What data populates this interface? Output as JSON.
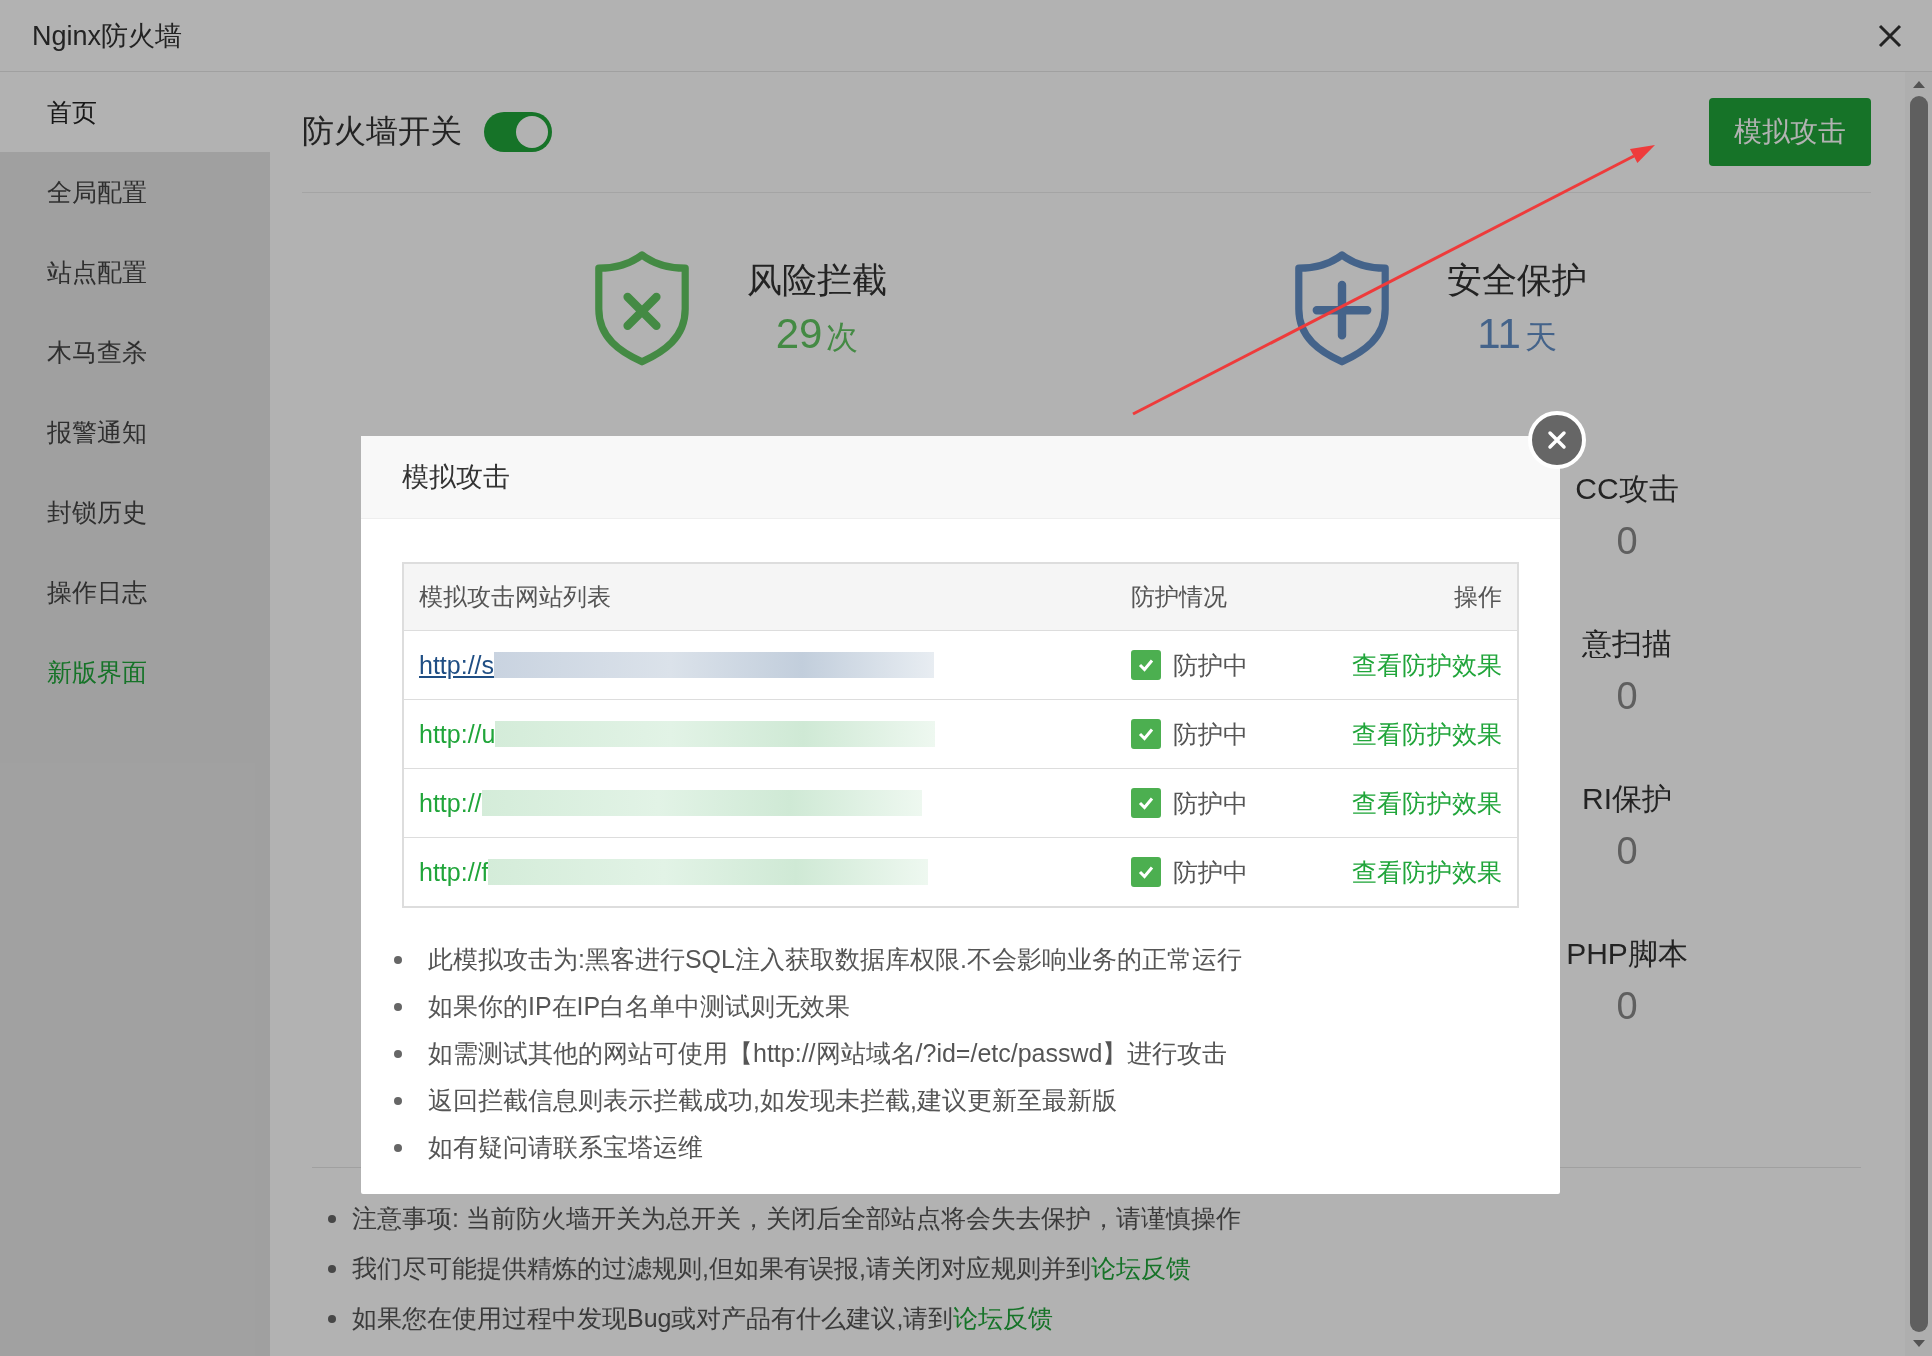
{
  "window": {
    "title": "Nginx防火墙"
  },
  "sidebar": {
    "items": [
      {
        "label": "首页",
        "selected": true,
        "kind": "page"
      },
      {
        "label": "全局配置",
        "selected": false,
        "kind": "page"
      },
      {
        "label": "站点配置",
        "selected": false,
        "kind": "page"
      },
      {
        "label": "木马查杀",
        "selected": false,
        "kind": "page"
      },
      {
        "label": "报警通知",
        "selected": false,
        "kind": "page"
      },
      {
        "label": "封锁历史",
        "selected": false,
        "kind": "page"
      },
      {
        "label": "操作日志",
        "selected": false,
        "kind": "page"
      },
      {
        "label": "新版界面",
        "selected": false,
        "kind": "link"
      }
    ]
  },
  "header": {
    "switch": {
      "label": "防火墙开关",
      "on": true
    },
    "button": "模拟攻击"
  },
  "stats": [
    {
      "kind": "blocked",
      "title": "风险拦截",
      "value": "29",
      "unit": "次",
      "color": "#448a44"
    },
    {
      "kind": "protected",
      "title": "安全保护",
      "value": "11",
      "unit": "天",
      "color": "#44638a"
    }
  ],
  "rules": [
    {
      "label": "CC攻击",
      "value": "0"
    },
    {
      "label": "意扫描",
      "value": "0"
    },
    {
      "label": "RI保护",
      "value": "0"
    },
    {
      "label": "PHP脚本",
      "value": "0"
    }
  ],
  "notes": [
    {
      "text": "注意事项: 当前防火墙开关为总开关，关闭后全部站点将会失去保护，请谨慎操作"
    },
    {
      "text": "我们尽可能提供精炼的过滤规则,但如果有误报,请关闭对应规则并到",
      "link": "论坛反馈"
    },
    {
      "text": "如果您在使用过程中发现Bug或对产品有什么建议,请到",
      "link": "论坛反馈"
    }
  ],
  "modal": {
    "title": "模拟攻击",
    "table": {
      "columns": [
        "模拟攻击网站列表",
        "防护情况",
        "操作"
      ],
      "rows": [
        {
          "url": "http://s",
          "visited": true,
          "protected": true,
          "status": "防护中",
          "action": "查看防护效果"
        },
        {
          "url": "http://u",
          "visited": false,
          "protected": true,
          "status": "防护中",
          "action": "查看防护效果"
        },
        {
          "url": "http://",
          "visited": false,
          "protected": true,
          "status": "防护中",
          "action": "查看防护效果"
        },
        {
          "url": "http://f",
          "visited": false,
          "protected": true,
          "status": "防护中",
          "action": "查看防护效果"
        }
      ]
    },
    "bullets": [
      "此模拟攻击为:黑客进行SQL注入获取数据库权限.不会影响业务的正常运行",
      "如果你的IP在IP白名单中测试则无效果",
      "如需测试其他的网站可使用【http://网站域名/?id=/etc/passwd】进行攻击",
      "返回拦截信息则表示拦截成功,如发现未拦截,建议更新至最新版",
      "如有疑问请联系宝塔运维"
    ]
  }
}
